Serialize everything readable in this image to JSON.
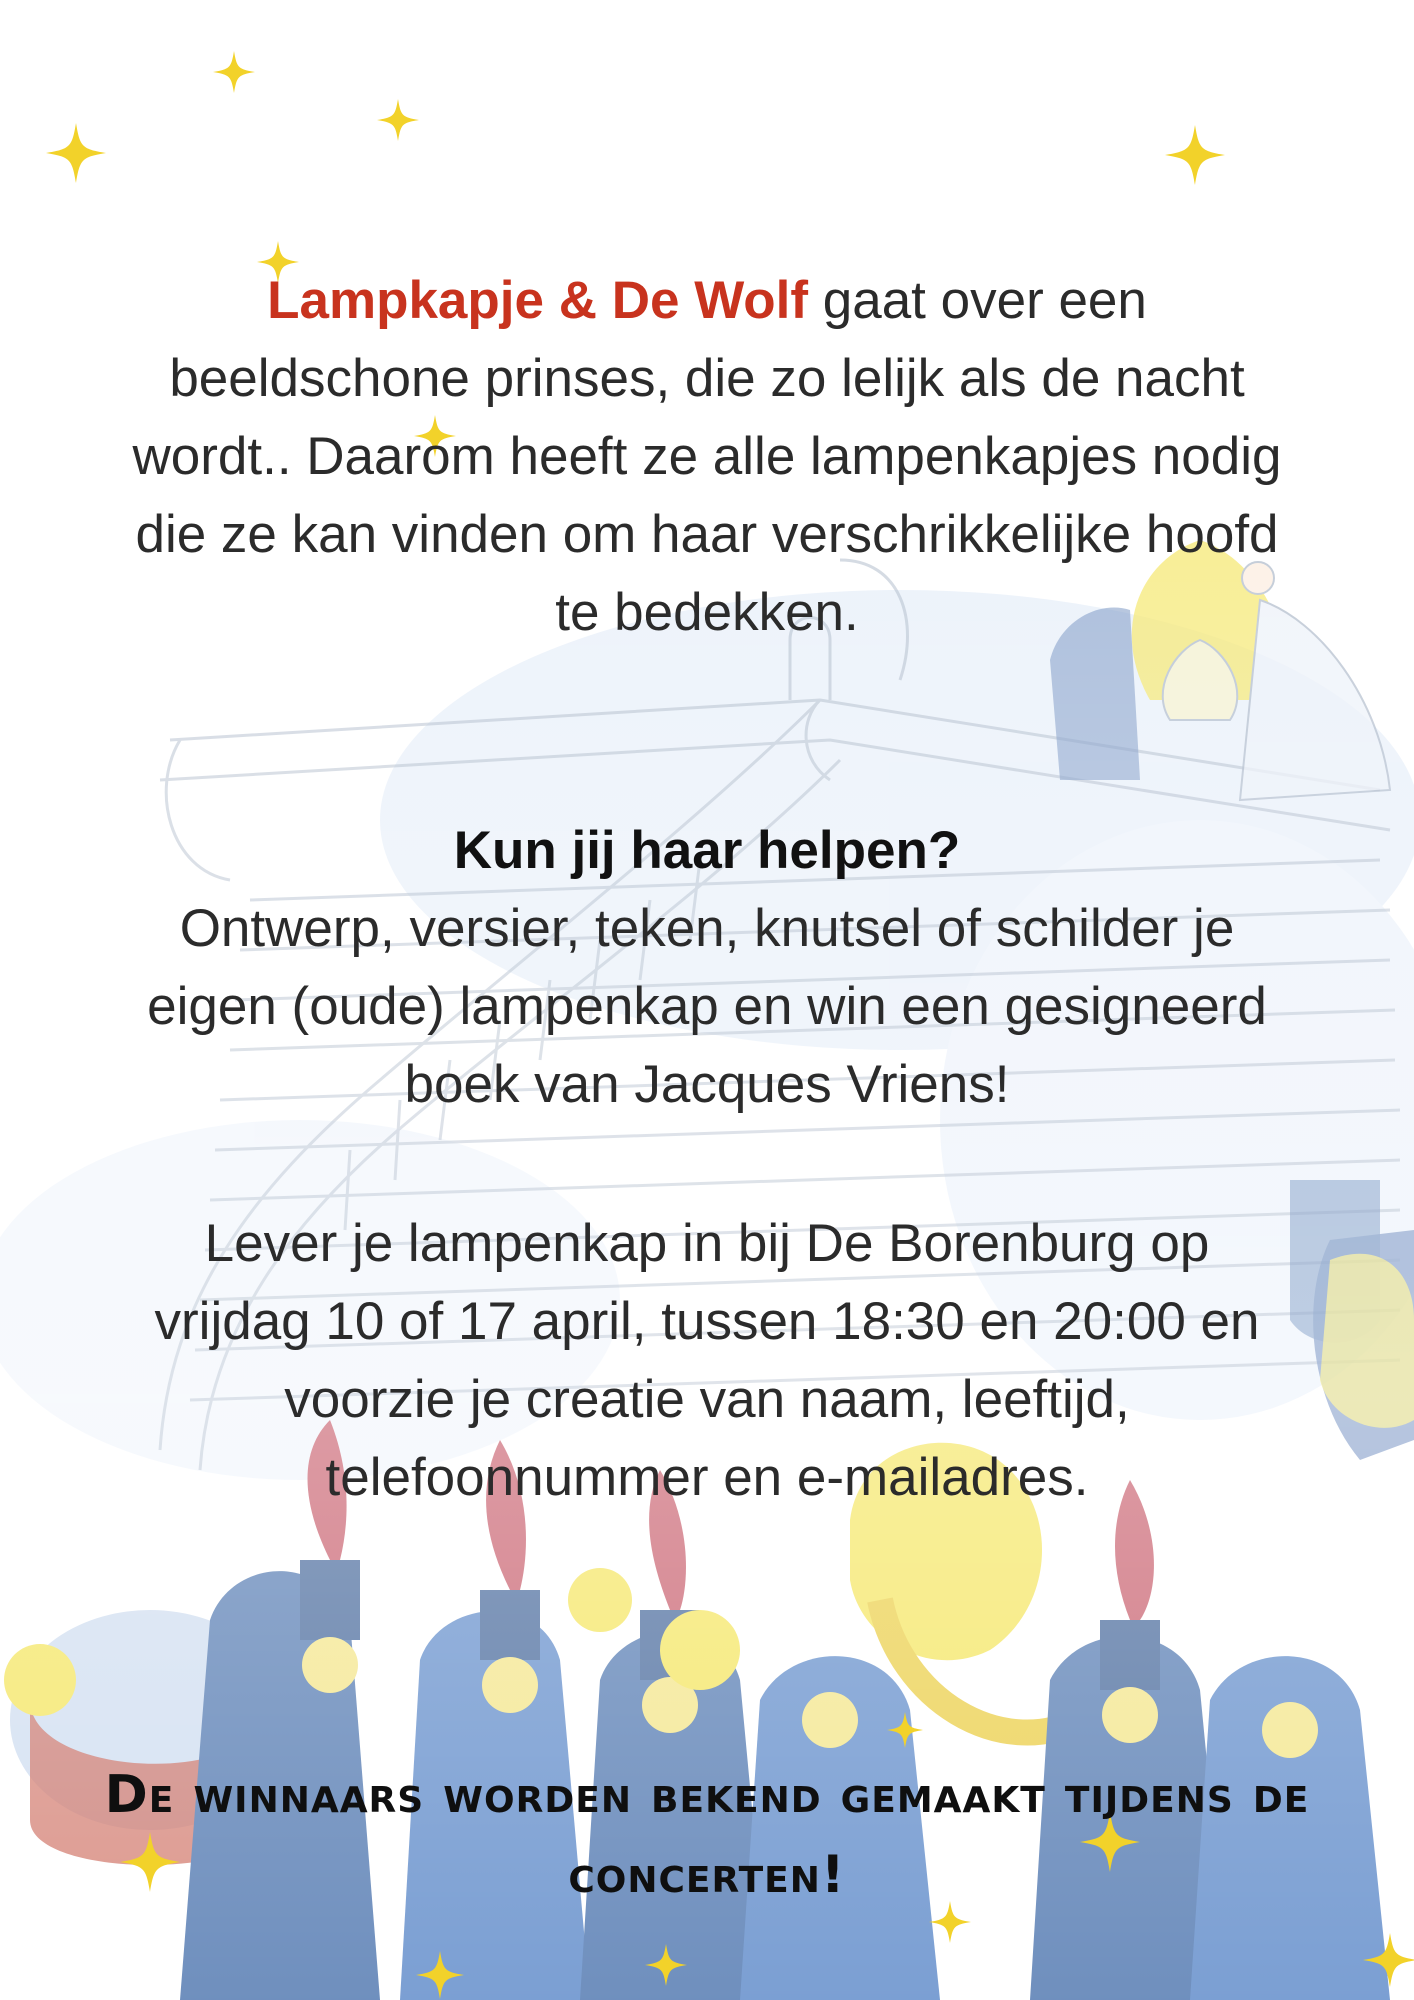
{
  "intro": {
    "title": "Lampkapje & De Wolf",
    "text": "gaat over een beeldschone prinses, die zo lelijk als de nacht wordt.. Daarom heeft ze alle lampenkapjes nodig die ze kan vinden om haar verschrikkelijke hoofd te bedekken."
  },
  "question": {
    "heading": "Kun jij haar helpen?",
    "text": "Ontwerp, versier, teken, knutsel of schilder je eigen (oude) lampenkap en win een gesigneerd boek van Jacques Vriens!"
  },
  "delivery": {
    "text": "Lever je lampenkap in bij De Borenburg op vrijdag 10 of 17 april, tussen 18:30 en 20:00 en voorzie je creatie van naam, leeftijd, telefoonnummer en e-mailadres."
  },
  "winners": {
    "text": "De winnaars worden bekend gemaakt tijdens de concerten!"
  },
  "colors": {
    "title_red": "#c8331e",
    "star_yellow": "#f2d22a",
    "illustration_blue": "#4f7fc4",
    "illustration_yellow": "#f3e24a"
  },
  "icons": [
    "star-icon"
  ]
}
